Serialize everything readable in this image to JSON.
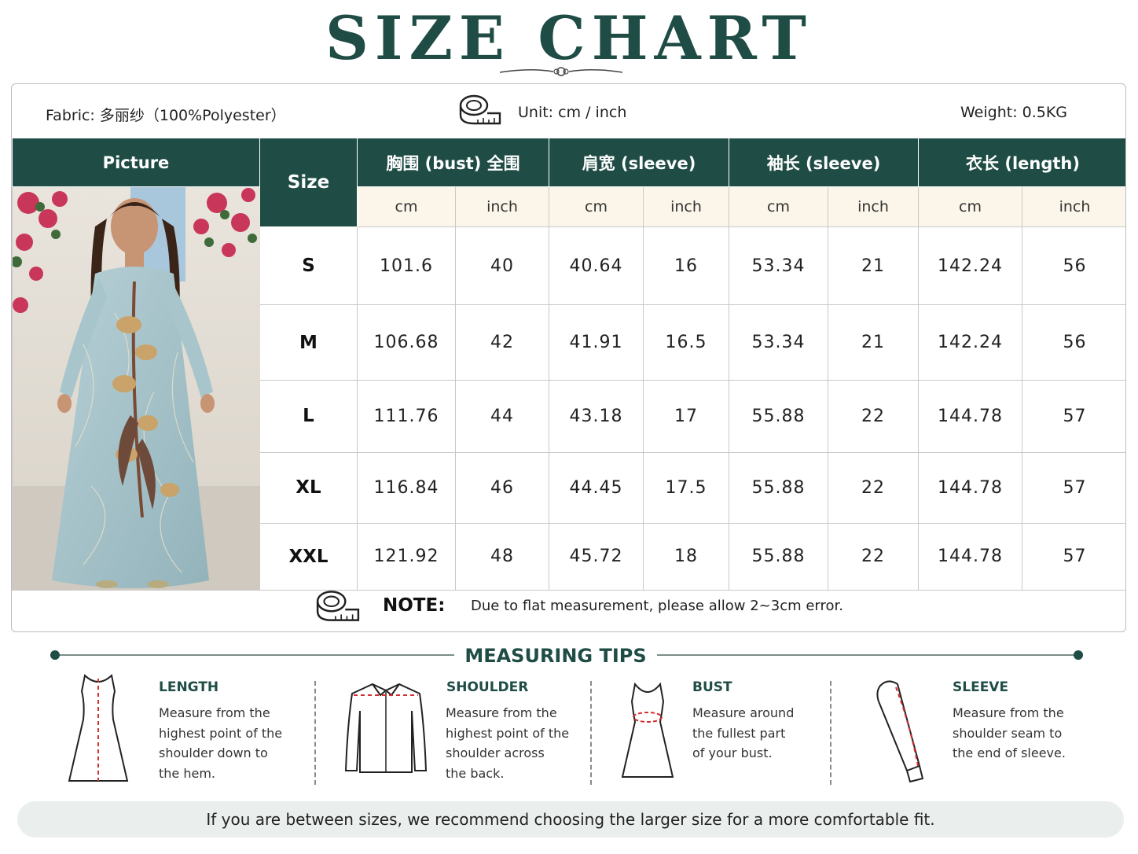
{
  "title": "SIZE CHART",
  "info": {
    "fabric": "Fabric:  多丽纱（100%Polyester）",
    "unit": "Unit:  cm / inch",
    "weight": "Weight:  0.5KG"
  },
  "table": {
    "picture_header": "Picture",
    "size_header": "Size",
    "groups": [
      "胸围 (bust) 全围",
      "肩宽 (sleeve)",
      "袖长 (sleeve)",
      "衣长 (length)"
    ],
    "units": [
      "cm",
      "inch",
      "cm",
      "inch",
      "cm",
      "inch",
      "cm",
      "inch"
    ],
    "rows": [
      {
        "size": "S",
        "values": [
          "101.6",
          "40",
          "40.64",
          "16",
          "53.34",
          "21",
          "142.24",
          "56"
        ]
      },
      {
        "size": "M",
        "values": [
          "106.68",
          "42",
          "41.91",
          "16.5",
          "53.34",
          "21",
          "142.24",
          "56"
        ]
      },
      {
        "size": "L",
        "values": [
          "111.76",
          "44",
          "43.18",
          "17",
          "55.88",
          "22",
          "144.78",
          "57"
        ]
      },
      {
        "size": "XL",
        "values": [
          "116.84",
          "46",
          "44.45",
          "17.5",
          "55.88",
          "22",
          "144.78",
          "57"
        ]
      },
      {
        "size": "XXL",
        "values": [
          "121.92",
          "48",
          "45.72",
          "18",
          "55.88",
          "22",
          "144.78",
          "57"
        ]
      }
    ]
  },
  "note": {
    "label": "NOTE:",
    "text": "Due to flat measurement, please allow 2~3cm error."
  },
  "tips": {
    "title": "MEASURING TIPS",
    "items": [
      {
        "heading": "LENGTH",
        "lines": [
          "Measure from the",
          "highest point of the",
          "shoulder down to",
          "the hem."
        ]
      },
      {
        "heading": "SHOULDER",
        "lines": [
          "Measure from the",
          "highest point of the",
          "shoulder across",
          "the back."
        ]
      },
      {
        "heading": "BUST",
        "lines": [
          "Measure around",
          "the fullest part",
          "of your bust."
        ]
      },
      {
        "heading": "SLEEVE",
        "lines": [
          "Measure from the",
          "shoulder seam to",
          "the end of sleeve."
        ]
      }
    ]
  },
  "footer": "If you are between sizes,  we recommend choosing the larger size for a more comfortable fit.",
  "colors": {
    "accent": "#1f4d45",
    "unit_row_bg": "#fbf6e9",
    "measure_line": "#d32f2f"
  }
}
